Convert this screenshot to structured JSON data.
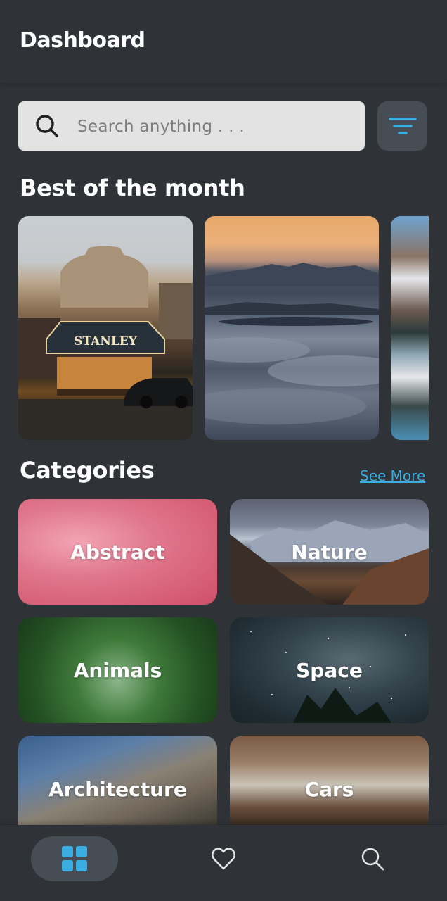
{
  "header": {
    "title": "Dashboard"
  },
  "search": {
    "placeholder": "Search anything . . ."
  },
  "best_of_month": {
    "title": "Best of the month"
  },
  "categories": {
    "title": "Categories",
    "see_more_label": "See More",
    "items": [
      {
        "label": "Abstract"
      },
      {
        "label": "Nature"
      },
      {
        "label": "Animals"
      },
      {
        "label": "Space"
      },
      {
        "label": "Architecture"
      },
      {
        "label": "Cars"
      }
    ]
  },
  "colors": {
    "background": "#2f3338",
    "accent": "#3aaee0",
    "search_bg": "#e3e3e3"
  },
  "bottom_nav": {
    "items": [
      {
        "icon": "grid-icon",
        "active": true
      },
      {
        "icon": "heart-icon",
        "active": false
      },
      {
        "icon": "search-icon",
        "active": false
      }
    ]
  }
}
